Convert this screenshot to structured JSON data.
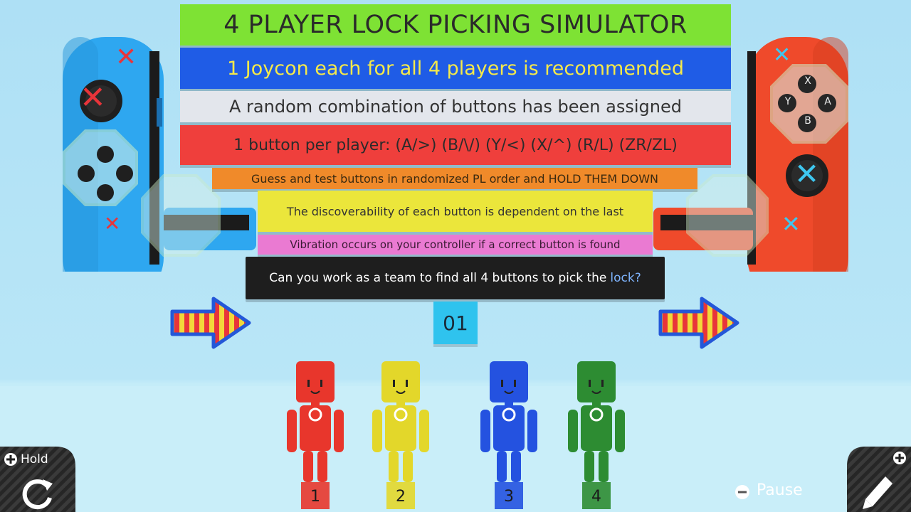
{
  "banners": {
    "title": "4 PLAYER LOCK PICKING SIMULATOR",
    "recommend": "1 Joycon each for all 4 players is recommended",
    "random": "A random combination of buttons has been assigned",
    "per_player": "1 button per player: (A/>) (B/\\/) (Y/<) (X/^) (R/L) (ZR/ZL)",
    "guess": "Guess and test buttons in randomized PL order and HOLD THEM DOWN",
    "discover": "The discoverability of each button is dependent on the last",
    "vibration": "Vibration occurs on your controller if a correct button is found",
    "question": "Can you work as a team to find all 4 buttons to pick the",
    "question_highlight": "lock?"
  },
  "counter": "01",
  "players": [
    {
      "number": "1",
      "color": "#e8362c"
    },
    {
      "number": "2",
      "color": "#e3d72a"
    },
    {
      "number": "3",
      "color": "#2452e0"
    },
    {
      "number": "4",
      "color": "#2d8c32"
    }
  ],
  "controls": {
    "hold_label": "Hold",
    "pause_label": "Pause"
  },
  "right_joycon_buttons": [
    "X",
    "Y",
    "A",
    "B"
  ],
  "colors": {
    "left_joycon": "#2ea7f0",
    "right_joycon": "#ef4a2b",
    "arrow_stripe_red": "#e8343a",
    "arrow_stripe_yellow": "#f2d83a"
  }
}
